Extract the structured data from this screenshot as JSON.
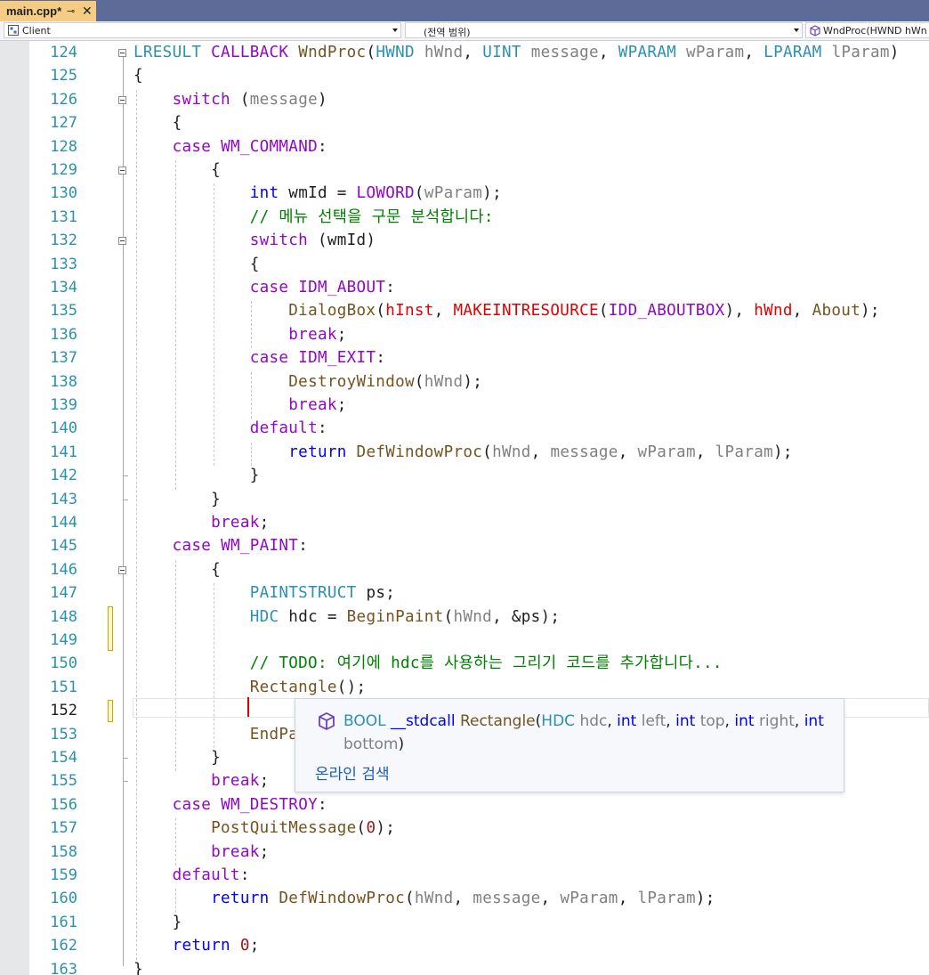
{
  "tab": {
    "title": "main.cpp*",
    "pin": "⊸",
    "close": "✕"
  },
  "nav": {
    "project": "Client",
    "scope": "(전역 범위)",
    "member": "WndProc(HWND hWn"
  },
  "colors": {
    "tab_bar": "#5d6b99",
    "active_tab": "#f5cc84",
    "keyword": "#0000ff",
    "function": "#74531f",
    "type": "#2b91af",
    "macro": "#8f08c4",
    "parameter": "#808080",
    "comment": "#008000",
    "line_number": "#2b91af"
  },
  "editor": {
    "current_line": "152",
    "lines": [
      {
        "n": "124",
        "html": "<span class='ty'>LRESULT</span> <span class='mac'>CALLBACK</span> <span class='fn'>WndProc</span>(<span class='ty'>HWND</span> <span class='pa'>hWnd</span>, <span class='ty'>UINT</span> <span class='pa'>message</span>, <span class='ty'>WPARAM</span> <span class='pa'>wParam</span>, <span class='ty'>LPARAM</span> <span class='pa'>lParam</span>)"
      },
      {
        "n": "125",
        "html": "{"
      },
      {
        "n": "126",
        "html": "    <span class='mac'>switch</span> (<span class='pa'>message</span>)"
      },
      {
        "n": "127",
        "html": "    {"
      },
      {
        "n": "128",
        "html": "    <span class='mac'>case</span> <span class='mac'>WM_COMMAND</span>:"
      },
      {
        "n": "129",
        "html": "        {"
      },
      {
        "n": "130",
        "html": "            <span class='kw'>int</span> wmId = <span class='mac'>LOWORD</span>(<span class='pa'>wParam</span>);"
      },
      {
        "n": "131",
        "html": "<span class='cm'>            // 메뉴 선택을 구문 분석합니다:</span>"
      },
      {
        "n": "132",
        "html": "            <span class='mac'>switch</span> (wmId)"
      },
      {
        "n": "133",
        "html": "            {"
      },
      {
        "n": "134",
        "html": "            <span class='mac'>case</span> <span class='mac'>IDM_ABOUT</span>:"
      },
      {
        "n": "135",
        "html": "                <span class='fn'>DialogBox</span>(<span class='red'>hInst</span>, <span class='red'>MAKEINTRESOURCE</span>(<span class='mac'>IDD_ABOUTBOX</span>), <span class='red'>hWnd</span>, <span class='fn'>About</span>);"
      },
      {
        "n": "136",
        "html": "                <span class='mac'>break</span>;"
      },
      {
        "n": "137",
        "html": "            <span class='mac'>case</span> <span class='mac'>IDM_EXIT</span>:"
      },
      {
        "n": "138",
        "html": "                <span class='fn'>DestroyWindow</span>(<span class='pa'>hWnd</span>);"
      },
      {
        "n": "139",
        "html": "                <span class='mac'>break</span>;"
      },
      {
        "n": "140",
        "html": "            <span class='mac'>default</span>:"
      },
      {
        "n": "141",
        "html": "                <span class='kw'>return</span> <span class='fn'>DefWindowProc</span>(<span class='pa'>hWnd</span>, <span class='pa'>message</span>, <span class='pa'>wParam</span>, <span class='pa'>lParam</span>);"
      },
      {
        "n": "142",
        "html": "            }"
      },
      {
        "n": "143",
        "html": "        }"
      },
      {
        "n": "144",
        "html": "        <span class='mac'>break</span>;"
      },
      {
        "n": "145",
        "html": "    <span class='mac'>case</span> <span class='mac'>WM_PAINT</span>:"
      },
      {
        "n": "146",
        "html": "        {"
      },
      {
        "n": "147",
        "html": "            <span class='ty'>PAINTSTRUCT</span> ps;"
      },
      {
        "n": "148",
        "html": "            <span class='ty'>HDC</span> hdc = <span class='fn'>BeginPaint</span>(<span class='pa'>hWnd</span>, &amp;ps);"
      },
      {
        "n": "149",
        "html": ""
      },
      {
        "n": "150",
        "html": "<span class='cm'>            // TODO: 여기에 hdc를 사용하는 그리기 코드를 추가합니다...</span>"
      },
      {
        "n": "151",
        "html": "            <span class='fn'>Rectangle</span>();"
      },
      {
        "n": "152",
        "html": ""
      },
      {
        "n": "153",
        "html": "            <span class='fn'>EndPa</span>"
      },
      {
        "n": "154",
        "html": "        }"
      },
      {
        "n": "155",
        "html": "        <span class='mac'>break</span>;"
      },
      {
        "n": "156",
        "html": "    <span class='mac'>case</span> <span class='mac'>WM_DESTROY</span>:"
      },
      {
        "n": "157",
        "html": "        <span class='fn'>PostQuitMessage</span>(<span class='num'>0</span>);"
      },
      {
        "n": "158",
        "html": "        <span class='mac'>break</span>;"
      },
      {
        "n": "159",
        "html": "    <span class='mac'>default</span>:"
      },
      {
        "n": "160",
        "html": "        <span class='kw'>return</span> <span class='fn'>DefWindowProc</span>(<span class='pa'>hWnd</span>, <span class='pa'>message</span>, <span class='pa'>wParam</span>, <span class='pa'>lParam</span>);"
      },
      {
        "n": "161",
        "html": "    }"
      },
      {
        "n": "162",
        "html": "    <span class='kw'>return</span> <span class='num'>0</span>;"
      },
      {
        "n": "163",
        "html": "}"
      }
    ]
  },
  "tooltip": {
    "signature_html": "<span class='ty'>BOOL</span> <span class='kw'>__stdcall</span> <span class='fn'>Rectangle</span>(<span class='ty'>HDC</span> <span class='pa'>hdc</span>, <span class='kw'>int</span> <span class='pa'>left</span>, <span class='kw'>int</span> <span class='pa'>top</span>, <span class='kw'>int</span> <span class='pa'>right</span>, <span class='kw'>int</span> <span class='pa'>bottom</span>)",
    "link": "온라인 검색",
    "icon": "cube-icon"
  }
}
